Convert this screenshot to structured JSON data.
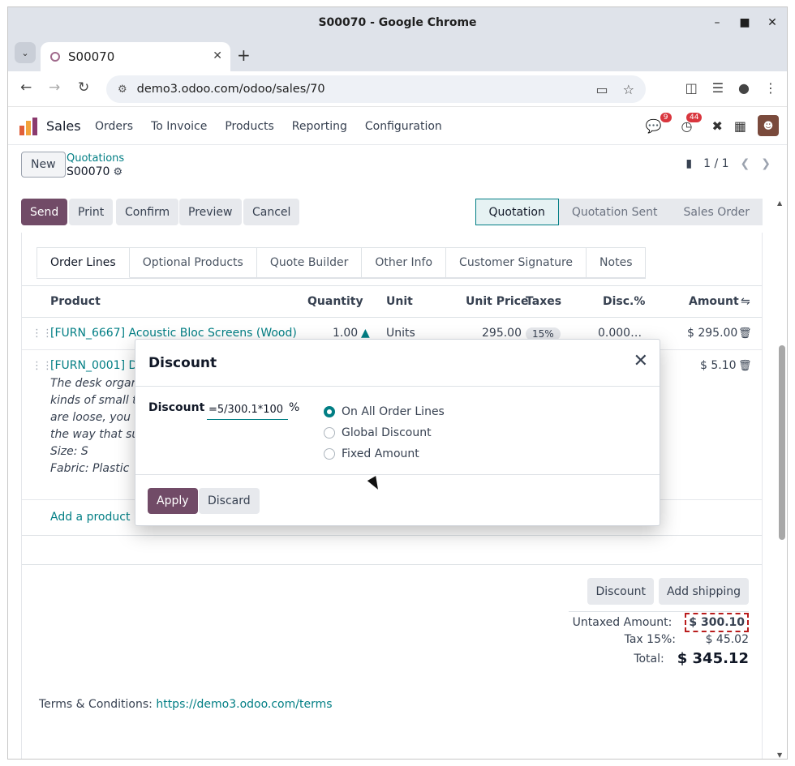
{
  "browser": {
    "window_title": "S00070 - Google Chrome",
    "tab_title": "S00070",
    "url": "demo3.odoo.com/odoo/sales/70"
  },
  "odoo": {
    "app_name": "Sales",
    "menu": [
      "Orders",
      "To Invoice",
      "Products",
      "Reporting",
      "Configuration"
    ],
    "messages_count": "9",
    "activities_count": "44"
  },
  "control": {
    "new_label": "New",
    "breadcrumb": "Quotations",
    "record": "S00070",
    "pager": "1 / 1"
  },
  "statusbar": {
    "buttons": [
      "Send",
      "Print",
      "Confirm",
      "Preview",
      "Cancel"
    ],
    "stages": [
      "Quotation",
      "Quotation Sent",
      "Sales Order"
    ]
  },
  "form": {
    "tabs": [
      "Order Lines",
      "Optional Products",
      "Quote Builder",
      "Other Info",
      "Customer Signature",
      "Notes"
    ],
    "columns": [
      "Product",
      "Quantity",
      "Unit",
      "Unit Price",
      "Taxes",
      "Disc.%",
      "Amount"
    ],
    "lines": [
      {
        "product": "[FURN_6667] Acoustic Bloc Screens (Wood)",
        "quantity": "1.00",
        "unit": "Units",
        "unit_price": "295.00",
        "tax": "15%",
        "discount": "0.000…",
        "amount": "$ 295.00"
      },
      {
        "product": "[FURN_0001] De",
        "desc1": "The desk organis",
        "desc2": "kinds of small thi",
        "desc3": "are loose, you ca",
        "desc4": "the way that suit",
        "desc5": "Size: S",
        "desc6": "Fabric: Plastic",
        "amount": "$ 5.10"
      }
    ],
    "add_product": "Add a product",
    "discount_button": "Discount",
    "shipping_button": "Add shipping",
    "untaxed_label": "Untaxed Amount:",
    "untaxed_value": "$ 300.10",
    "tax_label": "Tax 15%:",
    "tax_value": "$ 45.02",
    "total_label": "Total:",
    "total_value": "$ 345.12",
    "terms_label": "Terms & Conditions:",
    "terms_link": "https://demo3.odoo.com/terms"
  },
  "modal": {
    "title": "Discount",
    "field_label": "Discount",
    "field_value": "=5/300.1*100",
    "percent": "%",
    "options": [
      "On All Order Lines",
      "Global Discount",
      "Fixed Amount"
    ],
    "selected": "On All Order Lines",
    "apply_label": "Apply",
    "discard_label": "Discard"
  }
}
